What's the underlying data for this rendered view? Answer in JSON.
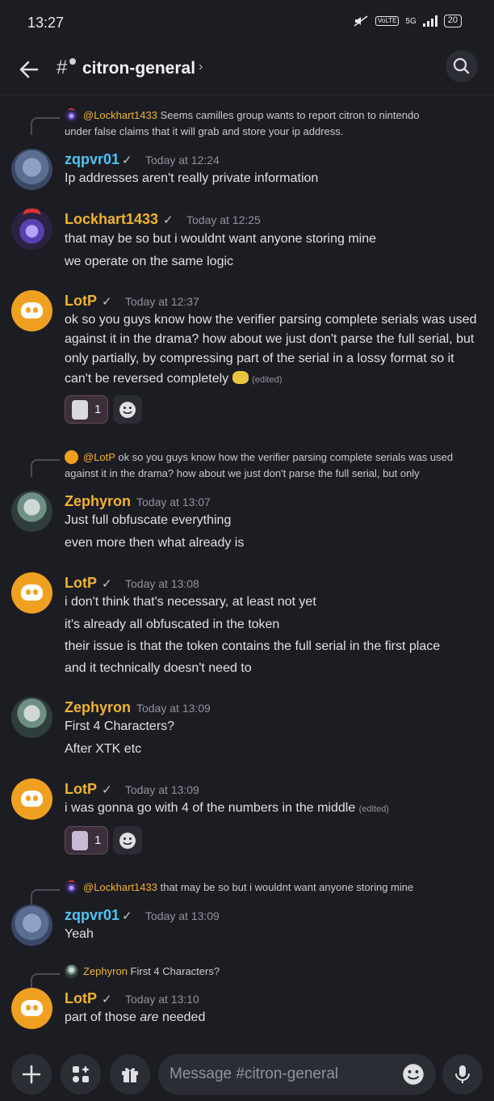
{
  "status": {
    "time": "13:27",
    "network": "5G",
    "volte": "VoLTE",
    "battery": "20"
  },
  "header": {
    "channel": "citron-general",
    "chevron": "›"
  },
  "messages": [
    {
      "reply": {
        "name": "@Lockhart1433",
        "text_line1": "Seems camilles group wants to report citron to nintendo",
        "text_line2": "under false claims that it will grab and store your ip address."
      },
      "user": "zqpvr01",
      "check": "✓",
      "time": "Today at 12:24",
      "lines": [
        "Ip addresses aren't really private information"
      ]
    },
    {
      "user": "Lockhart1433",
      "check": "✓",
      "time": "Today at 12:25",
      "lines": [
        "that may be so but i wouldnt want anyone storing mine",
        "we operate on the same logic"
      ]
    },
    {
      "user": "LotP",
      "check": "✓",
      "time": "Today at 12:37",
      "lines": [
        "ok so you guys know how the verifier parsing complete serials was used",
        "against it in the drama? how about we just don't parse the full serial, but",
        "only partially, by compressing part of the serial in a lossy format so it",
        "can't be reversed completely"
      ],
      "edited": "(edited)",
      "reaction_count": "1"
    },
    {
      "reply": {
        "name": "@LotP",
        "text_line1": "ok so you guys know how the verifier parsing complete serials was used",
        "text_line2": "against it in the drama? how about we just don't parse the full serial, but only"
      },
      "user": "Zephyron",
      "time": "Today at 13:07",
      "lines": [
        "Just full obfuscate everything",
        "even more then what already is"
      ]
    },
    {
      "user": "LotP",
      "check": "✓",
      "time": "Today at 13:08",
      "lines": [
        "i don't think that's necessary, at least not yet",
        "it's already all obfuscated in the token",
        "their issue is that the token contains the full serial in the first place",
        "and it technically doesn't need to"
      ]
    },
    {
      "user": "Zephyron",
      "time": "Today at 13:09",
      "lines": [
        "First 4 Characters?",
        "After XTK etc"
      ]
    },
    {
      "user": "LotP",
      "check": "✓",
      "time": "Today at 13:09",
      "lines": [
        "i was gonna go with 4 of the numbers in the middle"
      ],
      "edited": "(edited)",
      "reaction_count": "1"
    },
    {
      "reply": {
        "name": "@Lockhart1433",
        "text_line1": "that may be so but i wouldnt want anyone storing mine"
      },
      "user": "zqpvr01",
      "check": "✓",
      "time": "Today at 13:09",
      "lines": [
        "Yeah"
      ]
    },
    {
      "reply": {
        "name": "Zephyron",
        "text_line1": "First 4 Characters?"
      },
      "user": "LotP",
      "check": "✓",
      "time": "Today at 13:10",
      "lines_parts": {
        "a": "part of those ",
        "b": "are",
        "c": " needed"
      }
    }
  ],
  "composer": {
    "placeholder": "Message #citron-general"
  },
  "icons": {
    "back": "arrow-left-icon",
    "search": "search-icon",
    "add": "plus-icon",
    "apps": "apps-icon",
    "gift": "gift-icon",
    "emoji": "emoji-icon",
    "mic": "microphone-icon"
  },
  "colors": {
    "background": "#1c1d23",
    "username_blue": "#4ec3f0",
    "username_gold": "#f0b232",
    "discord_avatar": "#f0a020"
  }
}
